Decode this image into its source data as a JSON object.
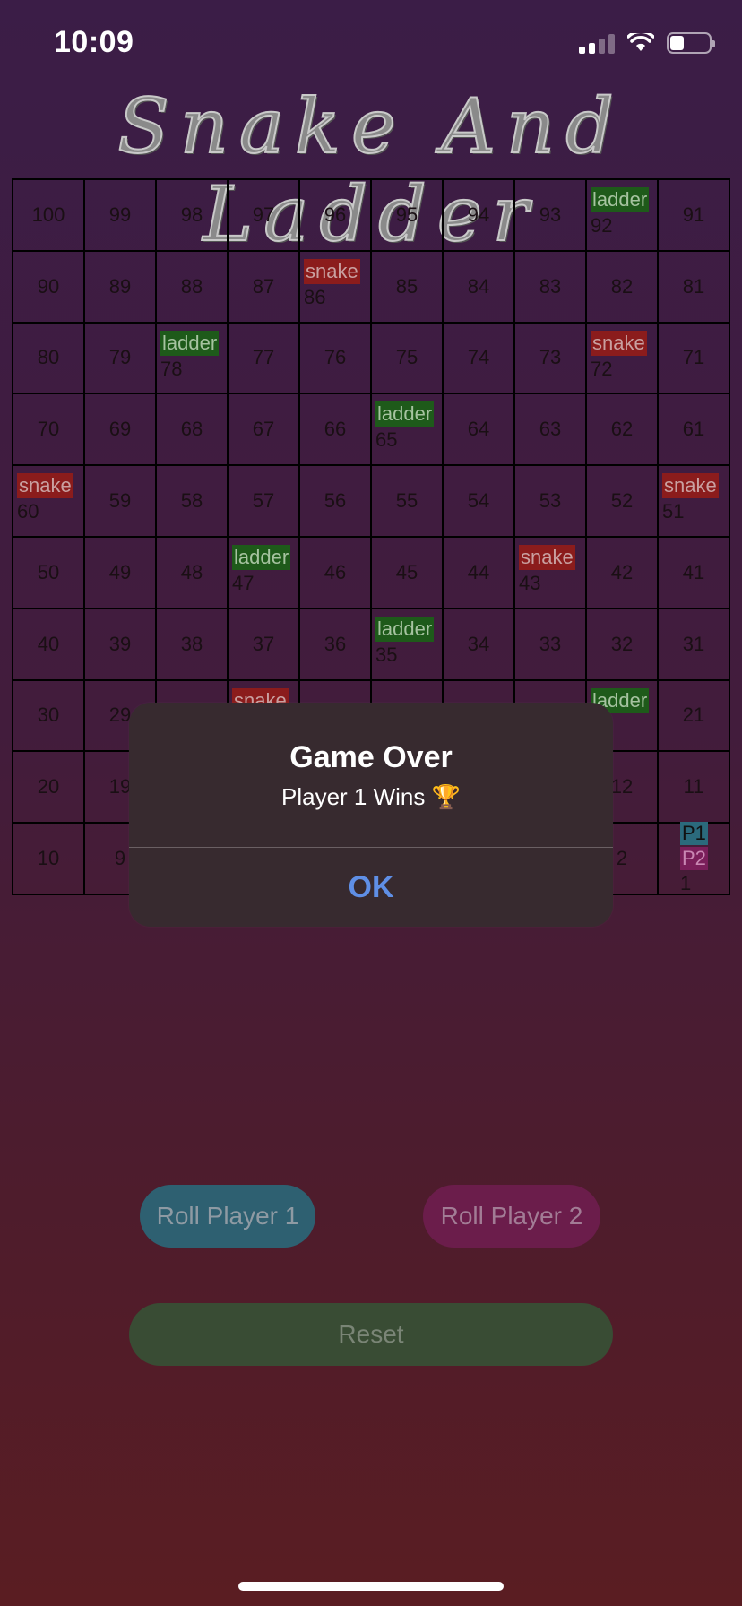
{
  "status_bar": {
    "time": "10:09",
    "signal_icon": "cellular-signal-icon",
    "wifi_icon": "wifi-icon",
    "battery_icon": "battery-icon",
    "battery_level": 0.35
  },
  "title": "Snake And Ladder",
  "board": {
    "rows": [
      [
        {
          "n": "100"
        },
        {
          "n": "99"
        },
        {
          "n": "98"
        },
        {
          "n": "97"
        },
        {
          "n": "96"
        },
        {
          "n": "95"
        },
        {
          "n": "94"
        },
        {
          "n": "93"
        },
        {
          "n": "92",
          "tag": "ladder"
        },
        {
          "n": "91"
        }
      ],
      [
        {
          "n": "90"
        },
        {
          "n": "89"
        },
        {
          "n": "88"
        },
        {
          "n": "87"
        },
        {
          "n": "86",
          "tag": "snake"
        },
        {
          "n": "85"
        },
        {
          "n": "84"
        },
        {
          "n": "83"
        },
        {
          "n": "82"
        },
        {
          "n": "81"
        }
      ],
      [
        {
          "n": "80"
        },
        {
          "n": "79"
        },
        {
          "n": "78",
          "tag": "ladder"
        },
        {
          "n": "77"
        },
        {
          "n": "76"
        },
        {
          "n": "75"
        },
        {
          "n": "74"
        },
        {
          "n": "73"
        },
        {
          "n": "72",
          "tag": "snake"
        },
        {
          "n": "71"
        }
      ],
      [
        {
          "n": "70"
        },
        {
          "n": "69"
        },
        {
          "n": "68"
        },
        {
          "n": "67"
        },
        {
          "n": "66"
        },
        {
          "n": "65",
          "tag": "ladder"
        },
        {
          "n": "64"
        },
        {
          "n": "63"
        },
        {
          "n": "62"
        },
        {
          "n": "61"
        }
      ],
      [
        {
          "n": "60",
          "tag": "snake"
        },
        {
          "n": "59"
        },
        {
          "n": "58"
        },
        {
          "n": "57"
        },
        {
          "n": "56"
        },
        {
          "n": "55"
        },
        {
          "n": "54"
        },
        {
          "n": "53"
        },
        {
          "n": "52"
        },
        {
          "n": "51",
          "tag": "snake"
        }
      ],
      [
        {
          "n": "50"
        },
        {
          "n": "49"
        },
        {
          "n": "48"
        },
        {
          "n": "47",
          "tag": "ladder"
        },
        {
          "n": "46"
        },
        {
          "n": "45"
        },
        {
          "n": "44"
        },
        {
          "n": "43",
          "tag": "snake"
        },
        {
          "n": "42"
        },
        {
          "n": "41"
        }
      ],
      [
        {
          "n": "40"
        },
        {
          "n": "39"
        },
        {
          "n": "38"
        },
        {
          "n": "37"
        },
        {
          "n": "36"
        },
        {
          "n": "35",
          "tag": "ladder"
        },
        {
          "n": "34"
        },
        {
          "n": "33"
        },
        {
          "n": "32"
        },
        {
          "n": "31"
        }
      ],
      [
        {
          "n": "30"
        },
        {
          "n": "29"
        },
        {
          "n": ""
        },
        {
          "n": "",
          "tag": "snake"
        },
        {
          "n": ""
        },
        {
          "n": ""
        },
        {
          "n": ""
        },
        {
          "n": ""
        },
        {
          "n": "",
          "tag": "ladder"
        },
        {
          "n": "21"
        }
      ],
      [
        {
          "n": "20"
        },
        {
          "n": "19"
        },
        {
          "n": ""
        },
        {
          "n": ""
        },
        {
          "n": ""
        },
        {
          "n": ""
        },
        {
          "n": ""
        },
        {
          "n": ""
        },
        {
          "n": "12"
        },
        {
          "n": "11"
        }
      ],
      [
        {
          "n": "10"
        },
        {
          "n": "9"
        },
        {
          "n": ""
        },
        {
          "n": ""
        },
        {
          "n": ""
        },
        {
          "n": ""
        },
        {
          "n": ""
        },
        {
          "n": ""
        },
        {
          "n": "2"
        },
        {
          "n": "1",
          "players": [
            "P1",
            "P2"
          ]
        }
      ]
    ],
    "tag_labels": {
      "snake": "snake",
      "ladder": "ladder"
    }
  },
  "alert": {
    "title": "Game Over",
    "message": "Player 1 Wins 🏆",
    "ok_label": "OK"
  },
  "buttons": {
    "roll_player_1": "Roll Player 1",
    "roll_player_2": "Roll Player 2",
    "reset": "Reset"
  },
  "colors": {
    "snake": "#8b1c1c",
    "ladder": "#1e5a1a",
    "player1": "#2e6071",
    "player2": "#6b1d4b",
    "reset": "#394c34",
    "alert_bg": "#372a2f",
    "ok": "#5f8fe6"
  }
}
